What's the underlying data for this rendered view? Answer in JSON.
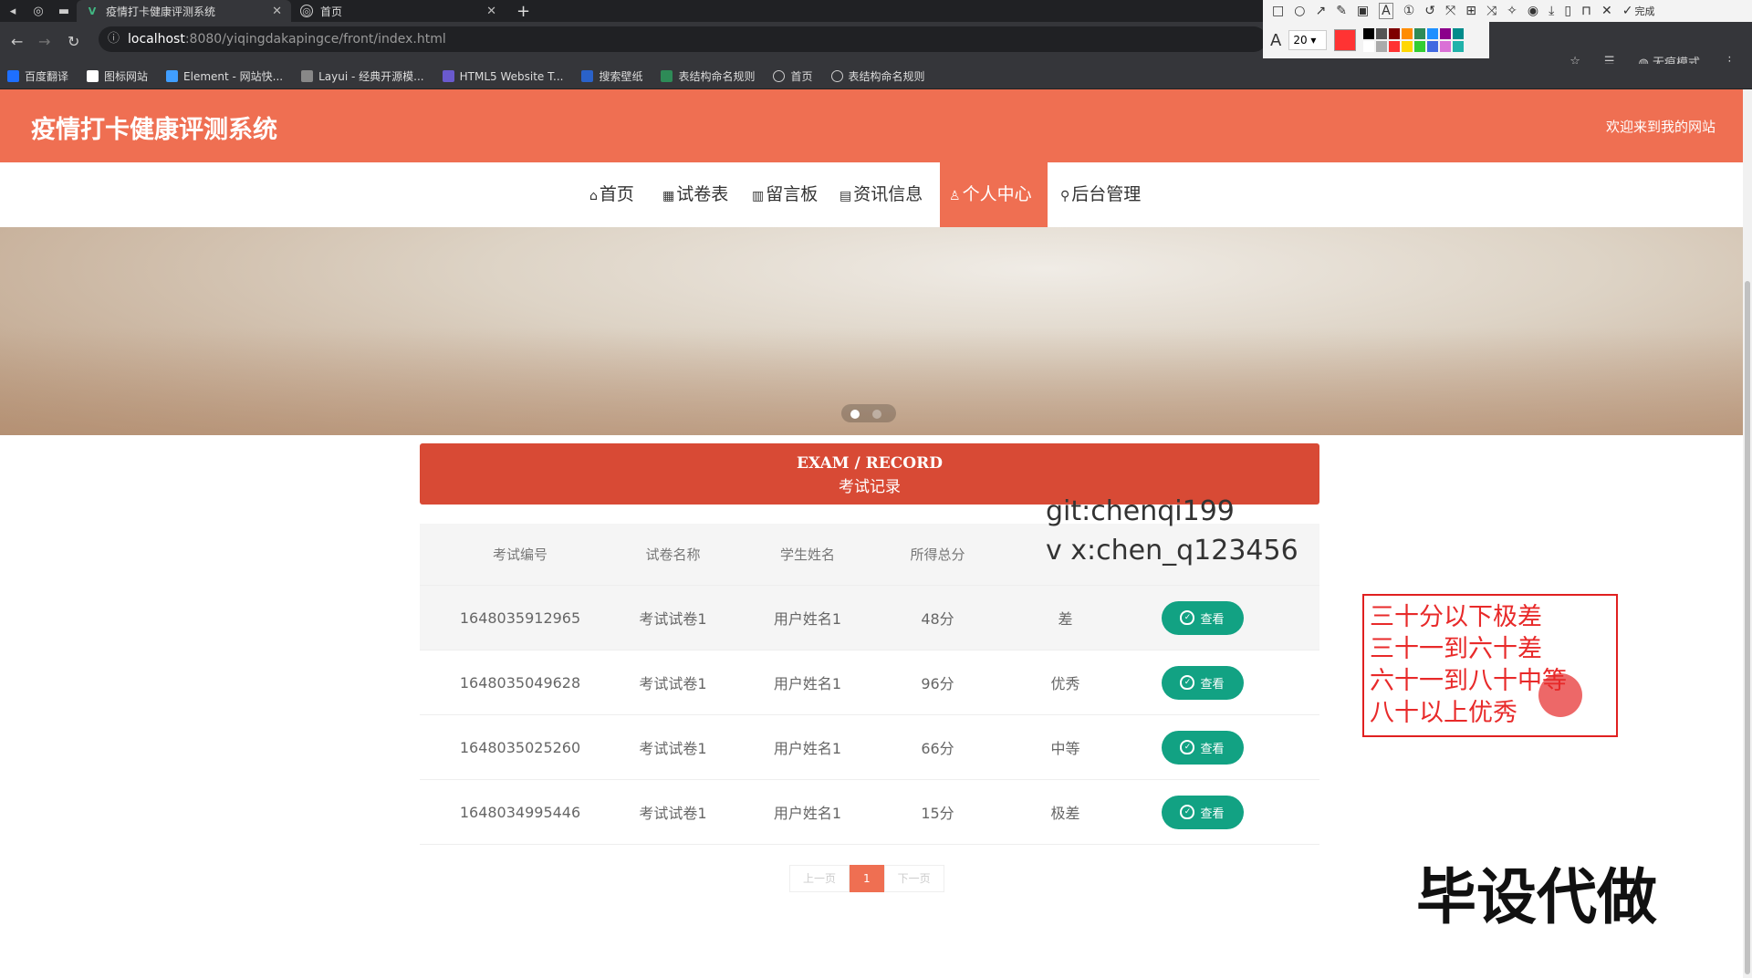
{
  "browser": {
    "tabs": [
      {
        "title": "疫情打卡健康评测系统"
      },
      {
        "title": "首页"
      }
    ],
    "url_host": "localhost",
    "url_path": ":8080/yiqingdakapingce/front/index.html",
    "incognito_label": "无痕模式",
    "bookmarks": [
      "百度翻译",
      "图标网站",
      "Element - 网站快...",
      "Layui - 经典开源模...",
      "HTML5 Website T...",
      "搜索壁纸",
      "表结构命名规则",
      "首页",
      "表结构命名规则"
    ]
  },
  "annotation_tool": {
    "done_label": "完成",
    "font_size": "20",
    "letter": "A",
    "current_color": "#ff3333",
    "palette": [
      "#000000",
      "#555555",
      "#7f0000",
      "#ff8c00",
      "#2e8b57",
      "#1e90ff",
      "#8b008b",
      "#008b8b",
      "#ffffff",
      "#aaaaaa",
      "#ff3333",
      "#ffd700",
      "#32cd32",
      "#4169e1",
      "#da70d6",
      "#20b2aa"
    ]
  },
  "site": {
    "title": "疫情打卡健康评测系统",
    "welcome": "欢迎来到我的网站",
    "accent_color": "#ef6f52",
    "nav": [
      {
        "label": "首页",
        "icon": "home-icon",
        "glyph": "⌂"
      },
      {
        "label": "试卷表",
        "icon": "grid-icon",
        "glyph": "▦"
      },
      {
        "label": "留言板",
        "icon": "message-icon",
        "glyph": "▥"
      },
      {
        "label": "资讯信息",
        "icon": "news-icon",
        "glyph": "▤"
      },
      {
        "label": "个人中心",
        "icon": "user-icon",
        "glyph": "♙"
      },
      {
        "label": "后台管理",
        "icon": "link-icon",
        "glyph": "⚲"
      }
    ]
  },
  "record": {
    "title_en": "EXAM / RECORD",
    "title_zh": "考试记录",
    "columns": [
      "考试编号",
      "试卷名称",
      "学生姓名",
      "所得总分",
      "",
      ""
    ],
    "view_label": "查看",
    "rows": [
      {
        "id": "1648035912965",
        "paper": "考试试卷1",
        "student": "用户姓名1",
        "score": "48分",
        "level": "差"
      },
      {
        "id": "1648035049628",
        "paper": "考试试卷1",
        "student": "用户姓名1",
        "score": "96分",
        "level": "优秀"
      },
      {
        "id": "1648035025260",
        "paper": "考试试卷1",
        "student": "用户姓名1",
        "score": "66分",
        "level": "中等"
      },
      {
        "id": "1648034995446",
        "paper": "考试试卷1",
        "student": "用户姓名1",
        "score": "15分",
        "level": "极差"
      }
    ],
    "pager": {
      "prev": "上一页",
      "current": "1",
      "next": "下一页"
    }
  },
  "overlay": {
    "watermark_line1": "git:chenqi199",
    "watermark_line2": "v x:chen_q123456",
    "note_lines": [
      "三十分以下极差",
      "三十一到六十差",
      "六十一到八十中等",
      "八十以上优秀"
    ],
    "promo": "毕设代做"
  }
}
